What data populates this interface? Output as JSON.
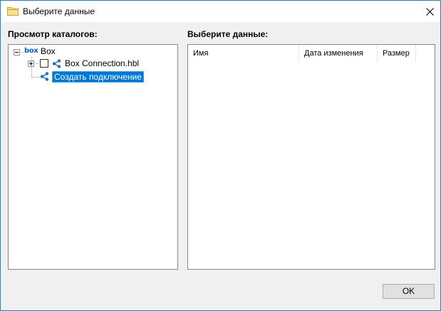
{
  "window": {
    "title": "Выберите данные",
    "title_icon": "folder-icon",
    "close_icon": "close-icon"
  },
  "catalog": {
    "label": "Просмотр каталогов:",
    "tree": {
      "root": {
        "label": "Box",
        "logo_text": "box",
        "expanded": true
      },
      "children": [
        {
          "label": "Box Connection.hbl",
          "icon": "share-icon",
          "checked": false,
          "expanded": false
        },
        {
          "label": "Создать подключение",
          "icon": "share-icon",
          "selected": true
        }
      ]
    }
  },
  "select": {
    "label": "Выберите данные:",
    "columns": [
      "Имя",
      "Дата изменения",
      "Размер"
    ]
  },
  "buttons": {
    "ok": "OK"
  },
  "colors": {
    "selection": "#0078d7",
    "box_brand": "#0061d5",
    "window_border": "#1883d7"
  }
}
